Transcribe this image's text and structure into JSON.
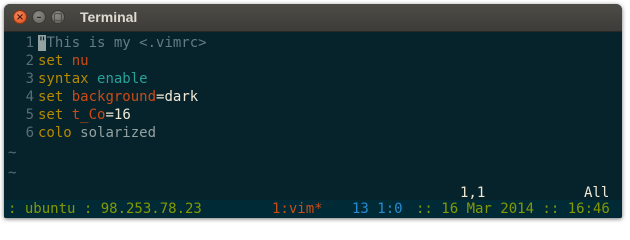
{
  "window": {
    "title": "Terminal",
    "close_glyph": "×",
    "minimize_glyph": "–",
    "maximize_glyph": "□"
  },
  "editor": {
    "lines": [
      {
        "num": "1",
        "cursor_char": "\"",
        "text": "This is my <.vimrc>"
      },
      {
        "num": "2",
        "cmd": "set",
        "arg": "nu"
      },
      {
        "num": "3",
        "cmd": "syntax",
        "arg": "enable"
      },
      {
        "num": "4",
        "cmd": "set",
        "arg": "background",
        "op": "=",
        "val": "dark"
      },
      {
        "num": "5",
        "cmd": "set",
        "arg": "t_Co",
        "op": "=",
        "val": "16"
      },
      {
        "num": "6",
        "cmd": "colo",
        "arg": "solarized"
      }
    ],
    "empty_marker": "~"
  },
  "ruler": {
    "position": "1,1",
    "scroll": "All"
  },
  "statusline": {
    "host": ": ubuntu : 98.253.78.23",
    "window": "1:vim*",
    "pane": "13 1:0",
    "date": ":: 16 Mar 2014 :: 16:46"
  },
  "colors": {
    "terminal_bg": "#06222b",
    "statusline_bg": "#002b36",
    "green": "#859900",
    "orange": "#cb4b16",
    "yellow": "#b58900",
    "cyan": "#2aa198",
    "blue": "#268bd2"
  },
  "icons": {
    "close": "close-icon",
    "minimize": "minimize-icon",
    "maximize": "maximize-icon"
  }
}
